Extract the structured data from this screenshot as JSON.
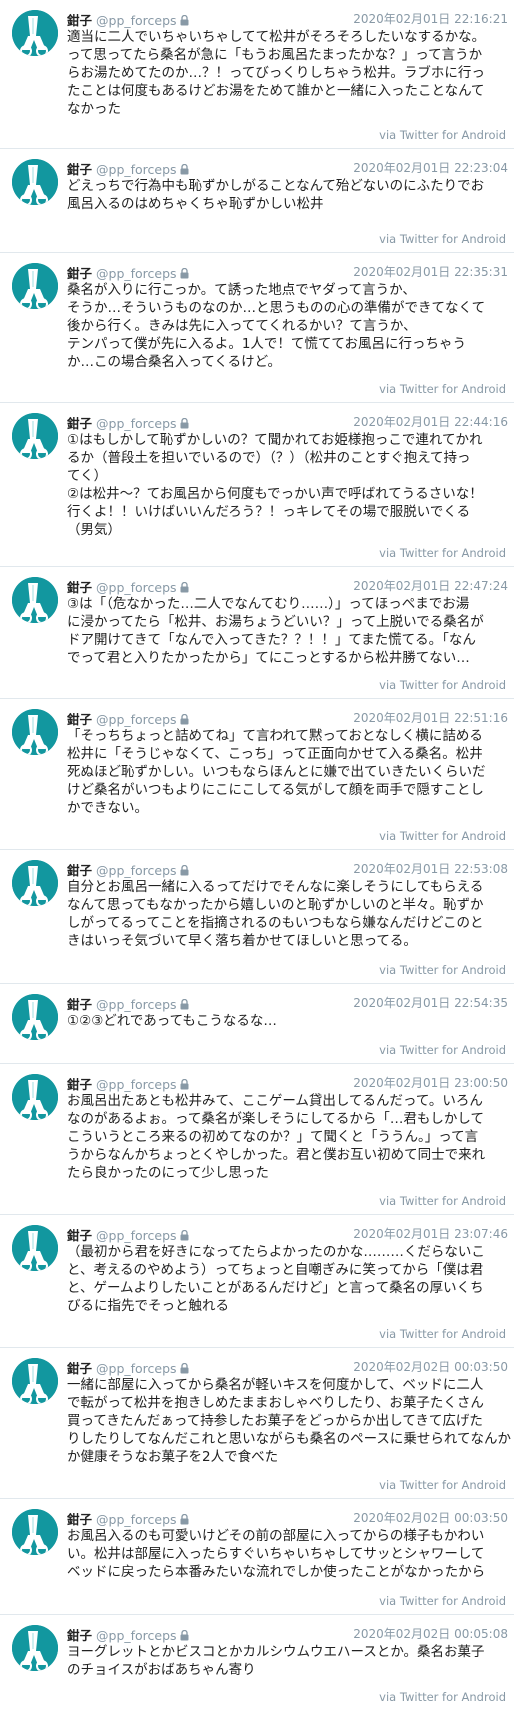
{
  "tweets": [
    {
      "name": "鉗子",
      "handle": "@pp_forceps",
      "time": "2020年02月01日 22:16:21",
      "text": "適当に二人でいちゃいちゃしてて松井がそろそろしたいなするかな。\nって思ってたら桑名が急に「もうお風呂たまったかな？」って言うか\nらお湯ためてたのか…？！ってびっくりしちゃう松井。ラブホに行っ\nたことは何度もあるけどお湯をためて誰かと一緒に入ったことなんて\nなかった",
      "via": "via Twitter for Android"
    },
    {
      "name": "鉗子",
      "handle": "@pp_forceps",
      "time": "2020年02月01日 22:23:04",
      "text": "どえっちで行為中も恥ずかしがることなんて殆どないのにふたりでお\n風呂入るのはめちゃくちゃ恥ずかしい松井",
      "via": "via Twitter for Android"
    },
    {
      "name": "鉗子",
      "handle": "@pp_forceps",
      "time": "2020年02月01日 22:35:31",
      "text": "桑名が入りに行こっか。て誘った地点でヤダって言うか、\nそうか…そういうものなのか…と思うものの心の準備ができてなくて\n後から行く。きみは先に入っててくれるかい？て言うか、\nテンパって僕が先に入るよ。1人で！て慌ててお風呂に行っちゃう\nか…この場合桑名入ってくるけど。",
      "via": "via Twitter for Android"
    },
    {
      "name": "鉗子",
      "handle": "@pp_forceps",
      "time": "2020年02月01日 22:44:16",
      "text": "①はもしかして恥ずかしいの？て聞かれてお姫様抱っこで連れてかれ\nるか（普段土を担いでいるので）（？）（松井のことすぐ抱えて持っ\nてく）\n②は松井〜？てお風呂から何度もでっかい声で呼ばれてうるさいな！\n行くよ！！いけばいいんだろう？！っキレてその場で服脱いでくる\n（男気）",
      "via": "via Twitter for Android"
    },
    {
      "name": "鉗子",
      "handle": "@pp_forceps",
      "time": "2020年02月01日 22:47:24",
      "text": "③は「（危なかった…二人でなんてむり……）」ってほっぺまでお湯\nに浸かってたら「松井、お湯ちょうどいい？」って上脱いでる桑名が\nドア開けてきて「なんで入ってきた？？！！」てまた慌てる。「なん\nでって君と入りたかったから」てにこっとするから松井勝てない…",
      "via": "via Twitter for Android"
    },
    {
      "name": "鉗子",
      "handle": "@pp_forceps",
      "time": "2020年02月01日 22:51:16",
      "text": "「そっちちょっと詰めてね」て言われて黙っておとなしく横に詰める\n松井に「そうじゃなくて、こっち」って正面向かせて入る桑名。松井\n死ぬほど恥ずかしい。いつもならほんとに嫌で出ていきたいくらいだ\nけど桑名がいつもよりにこにこしてる気がして顔を両手で隠すことし\nかできない。",
      "via": "via Twitter for Android"
    },
    {
      "name": "鉗子",
      "handle": "@pp_forceps",
      "time": "2020年02月01日 22:53:08",
      "text": "自分とお風呂一緒に入るってだけでそんなに楽しそうにしてもらえる\nなんて思ってもなかったから嬉しいのと恥ずかしいのと半々。恥ずか\nしがってるってことを指摘されるのもいつもなら嫌なんだけどこのと\nきはいっそ気づいて早く落ち着かせてほしいと思ってる。",
      "via": "via Twitter for Android"
    },
    {
      "name": "鉗子",
      "handle": "@pp_forceps",
      "time": "2020年02月01日 22:54:35",
      "text": "①②③どれであってもこうなるな…",
      "via": "via Twitter for Android"
    },
    {
      "name": "鉗子",
      "handle": "@pp_forceps",
      "time": "2020年02月01日 23:00:50",
      "text": "お風呂出たあとも松井みて、ここゲーム貸出してるんだって。いろん\nなのがあるよぉ。って桑名が楽しそうにしてるから「…君もしかして\nこういうところ来るの初めてなのか？」て聞くと「ううん。」って言\nうからなんかちょっとくやしかった。君と僕お互い初めて同士で来れ\nたら良かったのにって少し思った",
      "via": "via Twitter for Android"
    },
    {
      "name": "鉗子",
      "handle": "@pp_forceps",
      "time": "2020年02月01日 23:07:46",
      "text": "（最初から君を好きになってたらよかったのかな………くだらないこ\nと、考えるのやめよう）ってちょっと自嘲ぎみに笑ってから「僕は君\nと、ゲームよりしたいことがあるんだけど」と言って桑名の厚いくち\nびるに指先でそっと触れる",
      "via": "via Twitter for Android"
    },
    {
      "name": "鉗子",
      "handle": "@pp_forceps",
      "time": "2020年02月02日 00:03:50",
      "text": "一緒に部屋に入ってから桑名が軽いキスを何度かして、ベッドに二人\nで転がって松井を抱きしめたままおしゃべりしたり、お菓子たくさん\n買ってきたんだぁって持参したお菓子をどっからか出してきて広げた\nりしたりしてなんだこれと思いながらも桑名のペースに乗せられてなんか\nか健康そうなお菓子を2人で食べた",
      "via": "via Twitter for Android"
    },
    {
      "name": "鉗子",
      "handle": "@pp_forceps",
      "time": "2020年02月02日 00:03:50",
      "text": "お風呂入るのも可愛いけどその前の部屋に入ってからの様子もかわい\nい。松井は部屋に入ったらすぐいちゃいちゃしてサッとシャワーして\nベッドに戻ったら本番みたいな流れでしか使ったことがなかったから",
      "via": "via Twitter for Android"
    },
    {
      "name": "鉗子",
      "handle": "@pp_forceps",
      "time": "2020年02月02日 00:05:08",
      "text": "ヨーグレットとかビスコとかカルシウムウエハースとか。桑名お菓子\nのチョイスがおばあちゃん寄り",
      "via": "via Twitter for Android"
    }
  ]
}
